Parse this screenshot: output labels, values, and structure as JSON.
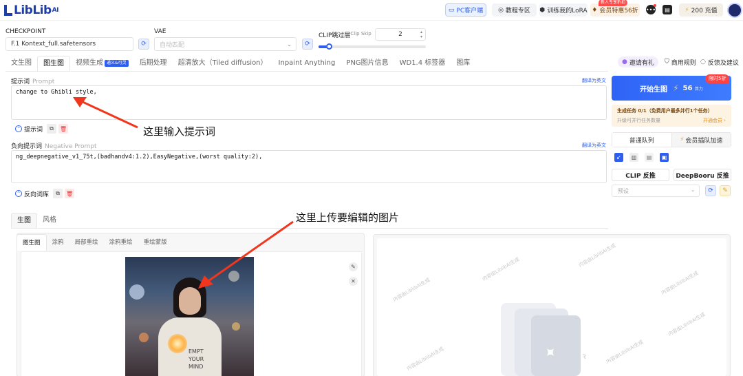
{
  "header": {
    "logo": "LibLib",
    "logo_sup": "AI",
    "pc_client": "PC客户端",
    "tutorials": "教程专区",
    "train_lora": "训练我的LoRA",
    "vip_badge": "新人专享折扣",
    "vip": "会员特惠56折",
    "balance": "200 充值"
  },
  "model_row": {
    "checkpoint_label": "CHECKPOINT",
    "checkpoint_value": "F.1 Kontext_full.safetensors",
    "vae_label": "VAE",
    "vae_placeholder": "自动匹配",
    "clip_label": "CLIP跳过层",
    "clip_label_en": "Clip Skip",
    "clip_value": "2",
    "clip_slider_fraction": 0.1
  },
  "tabs": [
    {
      "label": "文生图",
      "active": false
    },
    {
      "label": "图生图",
      "active": true
    },
    {
      "label": "视频生成",
      "active": false,
      "badge": "通义&可灵"
    },
    {
      "label": "后期处理",
      "active": false
    },
    {
      "label": "超清放大（Tiled diffusion）",
      "active": false
    },
    {
      "label": "Inpaint Anything",
      "active": false
    },
    {
      "label": "PNG图片信息",
      "active": false
    },
    {
      "label": "WD1.4 标签器",
      "active": false
    },
    {
      "label": "图库",
      "active": false
    }
  ],
  "right_links": {
    "invite": "邀请有礼",
    "rules": "商用规则",
    "feedback": "反馈及建议"
  },
  "prompt": {
    "label": "提示词",
    "label_en": "Prompt",
    "translate": "翻译为英文",
    "value": "change to Ghibli style,",
    "toggle": "提示词"
  },
  "negative": {
    "label": "负向提示词",
    "label_en": "Negative Prompt",
    "translate": "翻译为英文",
    "value": "ng_deepnegative_v1_75t,(badhandv4:1.2),EasyNegative,(worst quality:2),",
    "toggle": "反向词库"
  },
  "annotations": {
    "prompt_hint": "这里输入提示词",
    "upload_hint": "这里上传要编辑的图片"
  },
  "generate": {
    "label": "开始生图",
    "cost": "56",
    "cost_unit": "算力",
    "tag": "限时5折"
  },
  "task": {
    "line1": "生成任务 0/1（免费用户最多并行1个任务）",
    "line2": "升级可并行任务数量",
    "link": "开通会员 ›"
  },
  "queue": {
    "normal": "普通队列",
    "vip": "会员插队加速"
  },
  "reverse": {
    "clip": "CLIP 反推",
    "deepbooru": "DeepBooru 反推"
  },
  "preset": {
    "placeholder": "预设"
  },
  "image_section": {
    "subtabs": [
      {
        "label": "生图",
        "active": true
      },
      {
        "label": "风格",
        "active": false
      }
    ],
    "inner_tabs": [
      {
        "label": "图生图",
        "active": true
      },
      {
        "label": "涂鸦",
        "active": false
      },
      {
        "label": "局部重绘",
        "active": false
      },
      {
        "label": "涂鸦重绘",
        "active": false
      },
      {
        "label": "重绘蒙版",
        "active": false
      }
    ],
    "shirt_text": [
      "EMPT",
      "YOUR",
      "MIND"
    ],
    "watermark": "内容由LiblibAI生成"
  },
  "colors": {
    "accent": "#2d5ef0",
    "annotation_arrow": "#f0361c"
  }
}
